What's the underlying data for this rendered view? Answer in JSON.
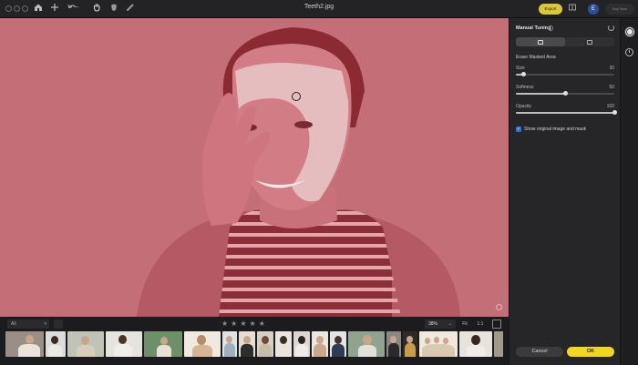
{
  "window": {
    "title": "Teeth2.jpg",
    "export_label": "Export",
    "buy_now_label": "Buy Now",
    "account_initial": "E"
  },
  "toolbar": {
    "icons": [
      "home-icon",
      "plus-icon",
      "undo-icon",
      "hand-icon",
      "mask-icon",
      "brush-icon"
    ]
  },
  "canvas": {
    "mask_color": "#c46f78"
  },
  "bottom_bar": {
    "filter_value": "All",
    "star_glyphs": [
      "★",
      "★",
      "★",
      "★",
      "★"
    ],
    "zoom_value": "38%",
    "zoom_caret": "⌄",
    "fit_label": "Fit",
    "one_to_one_label": "1:1"
  },
  "panel": {
    "title": "Manual Tuning",
    "help_glyph": "?",
    "section_label": "Erase Masked Area",
    "sliders": [
      {
        "label": "Size",
        "value": "30",
        "level": 0.08
      },
      {
        "label": "Softness",
        "value": "50",
        "level": 0.5
      },
      {
        "label": "Opacity",
        "value": "100",
        "level": 1.0
      }
    ],
    "checkbox": {
      "label": "Show original image and mask",
      "checked": true,
      "check_glyph": "✓"
    },
    "cancel_label": "Cancel",
    "ok_label": "OK"
  },
  "colors": {
    "accent_yellow": "#f2d81c",
    "checkbox_blue": "#2f6fd6"
  }
}
